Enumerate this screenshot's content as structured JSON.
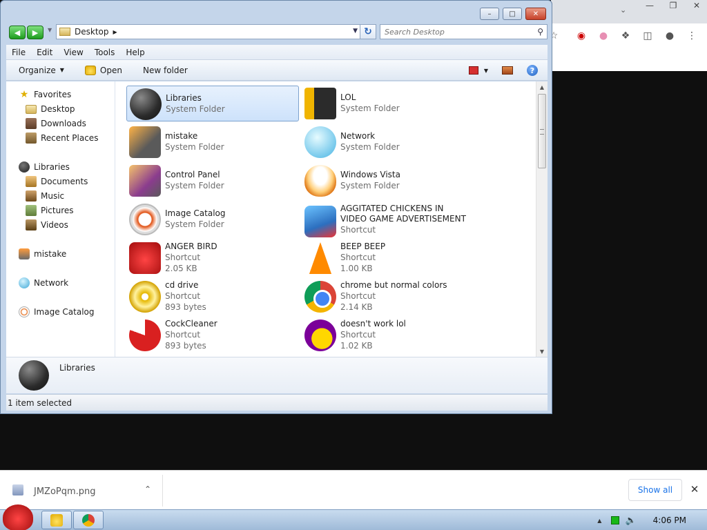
{
  "window": {
    "address": {
      "crumb": "Desktop"
    },
    "search": {
      "placeholder": "Search Desktop"
    },
    "menu": [
      "File",
      "Edit",
      "View",
      "Tools",
      "Help"
    ],
    "commands": {
      "organize": "Organize",
      "open": "Open",
      "new_folder": "New folder"
    },
    "nav": {
      "favorites": {
        "label": "Favorites",
        "items": [
          "Desktop",
          "Downloads",
          "Recent Places"
        ]
      },
      "libraries": {
        "label": "Libraries",
        "items": [
          "Documents",
          "Music",
          "Pictures",
          "Videos"
        ]
      },
      "mistake": "mistake",
      "network": "Network",
      "image_catalog": "Image Catalog"
    },
    "items": [
      {
        "name": "Libraries",
        "type": "System Folder",
        "size": "",
        "icon": "libraries-icon",
        "selected": true
      },
      {
        "name": "LOL",
        "type": "System Folder",
        "size": "",
        "icon": "lol-folder-icon"
      },
      {
        "name": "mistake",
        "type": "System Folder",
        "size": "",
        "icon": "mistake-folder-icon"
      },
      {
        "name": "Network",
        "type": "System Folder",
        "size": "",
        "icon": "network-icon"
      },
      {
        "name": "Control Panel",
        "type": "System Folder",
        "size": "",
        "icon": "control-panel-icon"
      },
      {
        "name": "Windows Vista",
        "type": "System Folder",
        "size": "",
        "icon": "windows-vista-icon"
      },
      {
        "name": "Image Catalog",
        "type": "System Folder",
        "size": "",
        "icon": "image-catalog-icon"
      },
      {
        "name": "AGGITATED CHICKENS IN VIDEO GAME ADVERTISEMENT",
        "type": "Shortcut",
        "size": "",
        "icon": "angry-birds-rio-icon"
      },
      {
        "name": "ANGER BIRD",
        "type": "Shortcut",
        "size": "2.05 KB",
        "icon": "angry-bird-icon"
      },
      {
        "name": "BEEP BEEP",
        "type": "Shortcut",
        "size": "1.00 KB",
        "icon": "vlc-cone-icon"
      },
      {
        "name": "cd drive",
        "type": "Shortcut",
        "size": "893 bytes",
        "icon": "cd-drive-icon"
      },
      {
        "name": "chrome but normal colors",
        "type": "Shortcut",
        "size": "2.14 KB",
        "icon": "chrome-icon"
      },
      {
        "name": "CockCleaner",
        "type": "Shortcut",
        "size": "893 bytes",
        "icon": "ccleaner-icon"
      },
      {
        "name": "doesn't work lol",
        "type": "Shortcut",
        "size": "1.02 KB",
        "icon": "yahoo-messenger-icon"
      }
    ],
    "details": {
      "name": "Libraries"
    },
    "status": "1 item selected"
  },
  "download_bar": {
    "file": "JMZoPqm.png",
    "show_all": "Show all"
  },
  "taskbar": {
    "clock": "4:06 PM"
  }
}
